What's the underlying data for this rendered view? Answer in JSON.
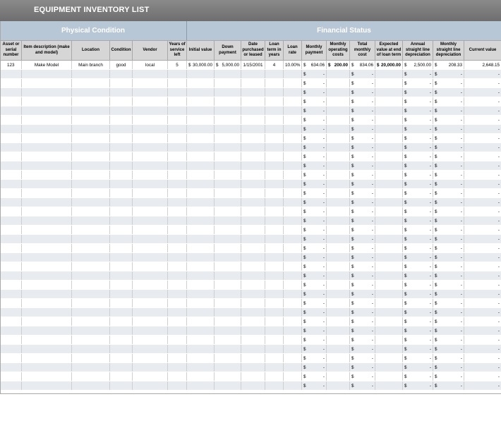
{
  "title": "EQUIPMENT INVENTORY LIST",
  "sections": {
    "physical": "Physical Condition",
    "financial": "Financial Status"
  },
  "headers": [
    "Asset or serial number",
    "Item description (make and model)",
    "Location",
    "Condition",
    "Vendor",
    "Years of service left",
    "Initial value",
    "Down payment",
    "Date purchased or leased",
    "Loan term in years",
    "Loan rate",
    "Monthly payment",
    "Monthly operating costs",
    "Total monthly cost",
    "Expected value at end of loan term",
    "Annual straight line depreciation",
    "Monthly straight line depreciation",
    "Current value"
  ],
  "first_row": {
    "asset": "123",
    "description": "Make Model",
    "location": "Main branch",
    "condition": "good",
    "vendor": "local",
    "years_left": "5",
    "initial_value": "30,000.00",
    "down_payment": "5,000.00",
    "date": "1/15/2001",
    "loan_term": "4",
    "loan_rate": "10.00%",
    "monthly_payment": "634.06",
    "monthly_operating": "200.00",
    "total_monthly": "834.06",
    "expected_value": "20,000.00",
    "annual_dep": "2,500.00",
    "monthly_dep": "208.33",
    "current_value": "2,648.15"
  },
  "empty_row": {
    "currency": "$",
    "dash": "-"
  },
  "empty_row_count": 35
}
